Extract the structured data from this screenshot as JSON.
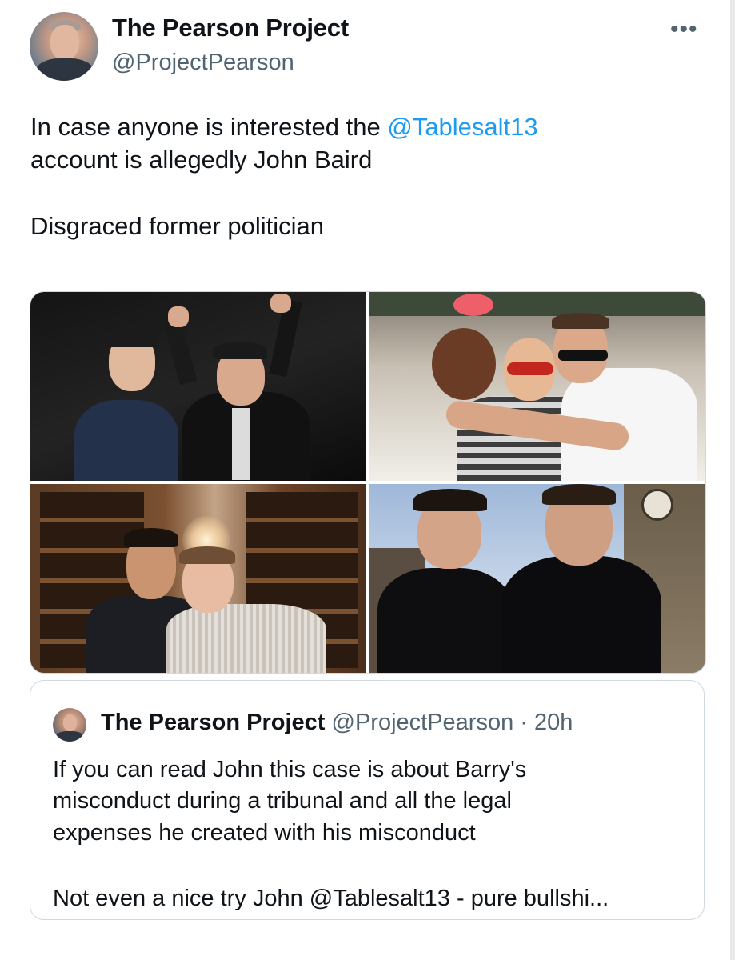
{
  "tweet": {
    "author": {
      "name": "The Pearson Project",
      "handle": "@ProjectPearson"
    },
    "more_label": "•••",
    "text": {
      "line1_prefix": "In case anyone is interested the ",
      "mention": "@Tablesalt13",
      "line2": "account is allegedly John Baird",
      "line3": "Disgraced former politician"
    },
    "media": [
      {
        "icon": "photo-two-men-cheering"
      },
      {
        "icon": "photo-two-men-sunglasses"
      },
      {
        "icon": "photo-two-men-wine-cellar"
      },
      {
        "icon": "photo-two-men-parliament"
      }
    ]
  },
  "quoted_tweet": {
    "author": {
      "name": "The Pearson Project",
      "handle": "@ProjectPearson",
      "separator": "·",
      "time": "20h"
    },
    "text": {
      "line1": "If you can read John this case is about Barry's",
      "line2": "misconduct during a tribunal and all the legal",
      "line3": "expenses he created with his misconduct",
      "line4": "Not even a nice try John @Tablesalt13 - pure bullshi..."
    }
  },
  "colors": {
    "accent": "#1d9bf0",
    "text": "#0f1419",
    "secondary": "#536471",
    "border": "#cfd9de"
  }
}
